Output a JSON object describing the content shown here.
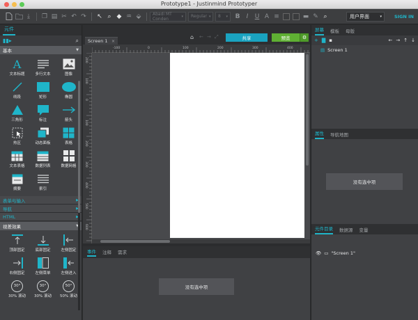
{
  "window": {
    "title": "Prototype1 - Justinmind Prototyper",
    "lights": [
      "#f4615a",
      "#f6be4f",
      "#5ccb57"
    ]
  },
  "toolbar": {
    "font_family": "Abadi MT Conden",
    "font_style": "Regular",
    "font_size": "8",
    "ui_mode": "用户界面",
    "signin": "SIGN IN"
  },
  "left": {
    "tabs": [
      "元件"
    ],
    "sections": {
      "basic": "基本",
      "forms": "表单与输入",
      "nav": "导航",
      "html": "HTML",
      "effects": "视差效果"
    },
    "basic_items": [
      "文本标题",
      "多行文本",
      "图像",
      "线段",
      "矩形",
      "椭圆",
      "三角形",
      "标注",
      "箭头",
      "热区",
      "动态面板",
      "表格",
      "文本表格",
      "数据列表",
      "数据网格",
      "摘要",
      "索引"
    ],
    "effect_items": [
      "顶部固定",
      "底部固定",
      "左侧固定",
      "右侧固定",
      "左侧菜单",
      "左侧进入",
      "30% 滚动",
      "30% 滚动",
      "50% 滚动"
    ],
    "effect_numbers": [
      "30°",
      "30°",
      "50°"
    ]
  },
  "center": {
    "doc_tab": "Screen 1",
    "share": "共享",
    "preview": "预览",
    "ruler_h": [
      "-100",
      "0",
      "100",
      "200",
      "300",
      "400",
      "500"
    ],
    "ruler_v": [
      "200",
      "100",
      "0",
      "100",
      "200",
      "300",
      "400",
      "500",
      "600"
    ],
    "bottom_tabs": [
      "事件",
      "注释",
      "需求"
    ],
    "no_selection": "没有选中项"
  },
  "right": {
    "top_tabs": [
      "屏幕",
      "模板",
      "母版"
    ],
    "screen_item": "Screen 1",
    "mid_tabs": [
      "属性",
      "导航地图"
    ],
    "no_selection": "没有选中项",
    "bottom_tabs": [
      "元件目录",
      "数据源",
      "变量"
    ],
    "outline_item": "\"Screen 1\""
  },
  "colors": {
    "accent": "#1fb5c9",
    "share": "#1aa3c0",
    "preview": "#5fb033"
  }
}
